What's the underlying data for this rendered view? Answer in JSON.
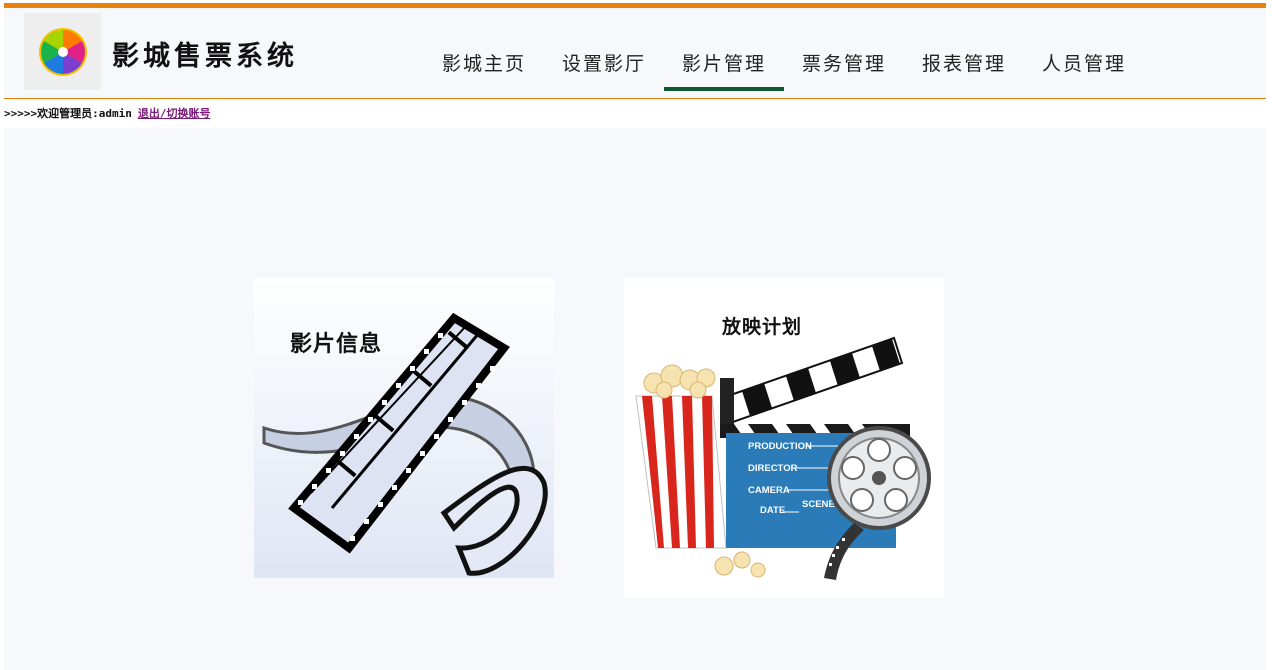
{
  "header": {
    "app_title": "影城售票系统",
    "logo_icon": "color-wheel-icon",
    "accent_color": "#e8820c",
    "active_color": "#0e5a2e"
  },
  "nav": {
    "items": [
      {
        "label": "影城主页"
      },
      {
        "label": "设置影厅"
      },
      {
        "label": "影片管理"
      },
      {
        "label": "票务管理"
      },
      {
        "label": "报表管理"
      },
      {
        "label": "人员管理"
      }
    ],
    "active": "影片管理"
  },
  "welcome": {
    "text": ">>>>>欢迎管理员:admin",
    "logout_link": "退出/切换账号"
  },
  "cards": {
    "film_info": {
      "label": "影片信息",
      "icon": "film-strip-icon"
    },
    "schedule": {
      "label": "放映计划",
      "icon": "clapperboard-popcorn-icon",
      "clap_lines": [
        "PRODUCTION",
        "DIRECTOR",
        "CAMERA",
        "DATE",
        "SCENE"
      ]
    }
  }
}
